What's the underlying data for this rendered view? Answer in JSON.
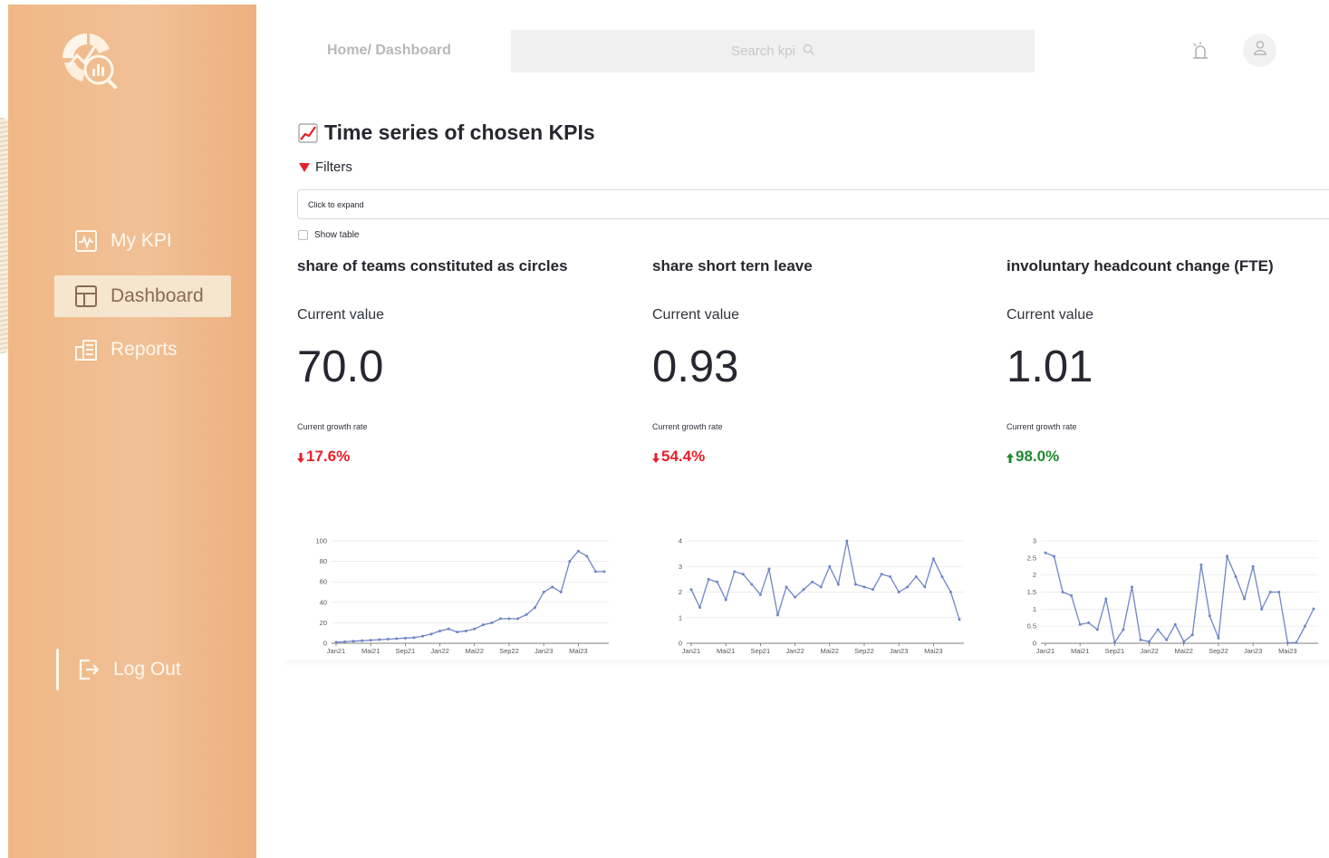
{
  "sidebar": {
    "items": [
      {
        "label": "My KPI",
        "icon": "activity-icon",
        "active": false
      },
      {
        "label": "Dashboard",
        "icon": "layout-icon",
        "active": true
      },
      {
        "label": "Reports",
        "icon": "reports-icon",
        "active": false
      }
    ],
    "logout_label": "Log Out",
    "colors": {
      "background": "#f1b886",
      "active_bg": "#f7e6cf",
      "text": "#fff8ef"
    }
  },
  "header": {
    "breadcrumb": "Home/ Dashboard",
    "search_placeholder": "Search kpi"
  },
  "main": {
    "title": "Time series of chosen KPIs",
    "filters_label": "Filters",
    "expander_label": "Click to expand",
    "show_table_label": "Show table"
  },
  "kpis": [
    {
      "name": "share of teams constituted as circles",
      "current_value_label": "Current value",
      "value": "70.0",
      "growth_label": "Current growth rate",
      "growth": "17.6%",
      "direction": "down"
    },
    {
      "name": "share short tern leave",
      "current_value_label": "Current value",
      "value": "0.93",
      "growth_label": "Current growth rate",
      "growth": "54.4%",
      "direction": "down"
    },
    {
      "name": "involuntary headcount change (FTE)",
      "current_value_label": "Current value",
      "value": "1.01",
      "growth_label": "Current growth rate",
      "growth": "98.0%",
      "direction": "up"
    }
  ],
  "colors": {
    "negative": "#e8202a",
    "positive": "#1e8b2e",
    "line": "#6f86c6"
  },
  "chart_data": [
    {
      "type": "line",
      "xticks": [
        "Jan21",
        "Mai21",
        "Sep21",
        "Jan22",
        "Mai22",
        "Sep22",
        "Jan23",
        "Mai23"
      ],
      "ylim": [
        0,
        100
      ],
      "yticks": [
        "0",
        "20",
        "40",
        "60",
        "80",
        "100"
      ],
      "ytick_values": [
        0,
        20,
        40,
        60,
        80,
        100
      ],
      "grid": true,
      "x": [
        "2021-01",
        "2021-02",
        "2021-03",
        "2021-04",
        "2021-05",
        "2021-06",
        "2021-07",
        "2021-08",
        "2021-09",
        "2021-10",
        "2021-11",
        "2021-12",
        "2022-01",
        "2022-02",
        "2022-03",
        "2022-04",
        "2022-05",
        "2022-06",
        "2022-07",
        "2022-08",
        "2022-09",
        "2022-10",
        "2022-11",
        "2022-12",
        "2023-01",
        "2023-02",
        "2023-03",
        "2023-04",
        "2023-05",
        "2023-06",
        "2023-07",
        "2023-08"
      ],
      "values": [
        1,
        1.5,
        2,
        2.5,
        3,
        3.5,
        4,
        4.5,
        5,
        5.5,
        7,
        9,
        12,
        14,
        11,
        12,
        14,
        18,
        20,
        24,
        24,
        24,
        28,
        35,
        50,
        55,
        50,
        80,
        90,
        85,
        70,
        70
      ]
    },
    {
      "type": "line",
      "xticks": [
        "Jan21",
        "Mai21",
        "Sep21",
        "Jan22",
        "Mai22",
        "Sep22",
        "Jan23",
        "Mai23"
      ],
      "ylim": [
        0,
        4
      ],
      "yticks": [
        "0",
        "1",
        "2",
        "3",
        "4"
      ],
      "ytick_values": [
        0,
        1,
        2,
        3,
        4
      ],
      "grid": true,
      "x": [
        "2021-01",
        "2021-02",
        "2021-03",
        "2021-04",
        "2021-05",
        "2021-06",
        "2021-07",
        "2021-08",
        "2021-09",
        "2021-10",
        "2021-11",
        "2021-12",
        "2022-01",
        "2022-02",
        "2022-03",
        "2022-04",
        "2022-05",
        "2022-06",
        "2022-07",
        "2022-08",
        "2022-09",
        "2022-10",
        "2022-11",
        "2022-12",
        "2023-01",
        "2023-02",
        "2023-03",
        "2023-04",
        "2023-05",
        "2023-06",
        "2023-07",
        "2023-08"
      ],
      "values": [
        2.1,
        1.4,
        2.5,
        2.4,
        1.7,
        2.8,
        2.7,
        2.3,
        1.9,
        2.9,
        1.1,
        2.2,
        1.8,
        2.1,
        2.4,
        2.2,
        3.0,
        2.3,
        4.0,
        2.3,
        2.2,
        2.1,
        2.7,
        2.6,
        2.0,
        2.2,
        2.6,
        2.2,
        3.3,
        2.6,
        2.0,
        0.93
      ]
    },
    {
      "type": "line",
      "xticks": [
        "Jan21",
        "Mai21",
        "Sep21",
        "Jan22",
        "Mai22",
        "Sep22",
        "Jan23",
        "Mai23"
      ],
      "ylim": [
        0,
        3
      ],
      "yticks": [
        "0",
        "0.5",
        "1",
        "1.5",
        "2",
        "2.5",
        "3"
      ],
      "ytick_values": [
        0,
        0.5,
        1,
        1.5,
        2,
        2.5,
        3
      ],
      "grid": true,
      "x": [
        "2021-01",
        "2021-02",
        "2021-03",
        "2021-04",
        "2021-05",
        "2021-06",
        "2021-07",
        "2021-08",
        "2021-09",
        "2021-10",
        "2021-11",
        "2021-12",
        "2022-01",
        "2022-02",
        "2022-03",
        "2022-04",
        "2022-05",
        "2022-06",
        "2022-07",
        "2022-08",
        "2022-09",
        "2022-10",
        "2022-11",
        "2022-12",
        "2023-01",
        "2023-02",
        "2023-03",
        "2023-04",
        "2023-05",
        "2023-06",
        "2023-07",
        "2023-08"
      ],
      "values": [
        2.65,
        2.55,
        1.5,
        1.4,
        0.55,
        0.6,
        0.4,
        1.3,
        0.02,
        0.4,
        1.65,
        0.1,
        0.05,
        0.4,
        0.1,
        0.55,
        0.05,
        0.25,
        2.3,
        0.8,
        0.15,
        2.55,
        1.95,
        1.3,
        2.25,
        1.0,
        1.5,
        1.5,
        0.01,
        0.02,
        0.5,
        1.01
      ]
    }
  ]
}
